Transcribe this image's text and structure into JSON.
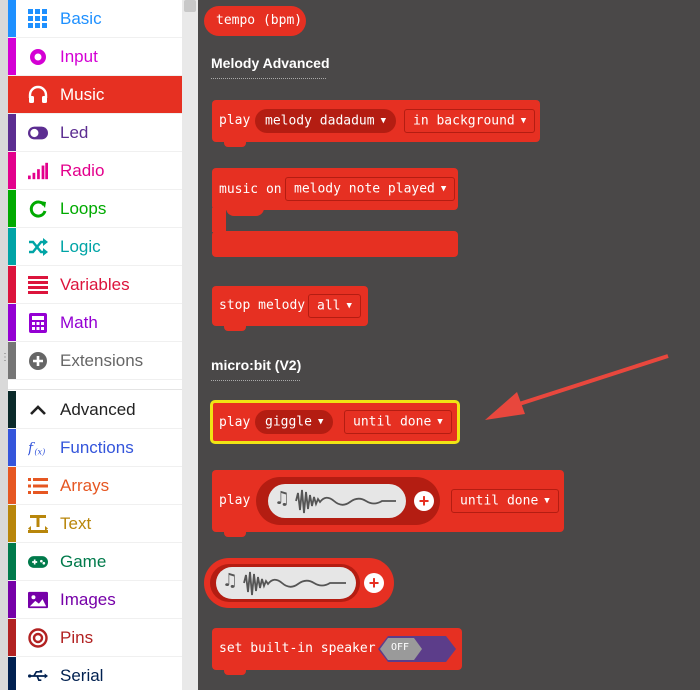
{
  "toolbox": {
    "categories": [
      {
        "label": "Basic",
        "color": "#1e90ff"
      },
      {
        "label": "Input",
        "color": "#d400d4"
      },
      {
        "label": "Music",
        "color": "#e63022",
        "selected": true
      },
      {
        "label": "Led",
        "color": "#5c2d91"
      },
      {
        "label": "Radio",
        "color": "#e3008c"
      },
      {
        "label": "Loops",
        "color": "#00aa00"
      },
      {
        "label": "Logic",
        "color": "#00a4a6"
      },
      {
        "label": "Variables",
        "color": "#dc143c"
      },
      {
        "label": "Math",
        "color": "#9400d3"
      },
      {
        "label": "Extensions",
        "color": "#757575"
      },
      {
        "label": "Advanced",
        "color": "#0b2a2a"
      },
      {
        "label": "Functions",
        "color": "#3455db"
      },
      {
        "label": "Arrays",
        "color": "#e65722"
      },
      {
        "label": "Text",
        "color": "#b8860b"
      },
      {
        "label": "Game",
        "color": "#007a4b"
      },
      {
        "label": "Images",
        "color": "#7600a8"
      },
      {
        "label": "Pins",
        "color": "#b22222"
      },
      {
        "label": "Serial",
        "color": "#002050"
      }
    ]
  },
  "flyout": {
    "tempo_block": "tempo (bpm)",
    "section_melody_advanced": "Melody Advanced",
    "play_melody": {
      "play": "play",
      "melody": "melody dadadum",
      "mode": "in background"
    },
    "music_on": {
      "label": "music on",
      "event": "melody note played"
    },
    "stop_melody": {
      "label": "stop melody",
      "option": "all"
    },
    "section_microbit": "micro:bit (V2)",
    "play_giggle": {
      "play": "play",
      "sound": "giggle",
      "mode": "until done"
    },
    "play_sound": {
      "play": "play",
      "mode": "until done"
    },
    "set_speaker": {
      "label": "set built-in speaker",
      "value": "OFF"
    }
  },
  "colors": {
    "music": "#e63022",
    "music_dark": "#b41d12",
    "highlight": "#f0e414",
    "arrow": "#e8473d",
    "workspace": "#4a4848"
  }
}
